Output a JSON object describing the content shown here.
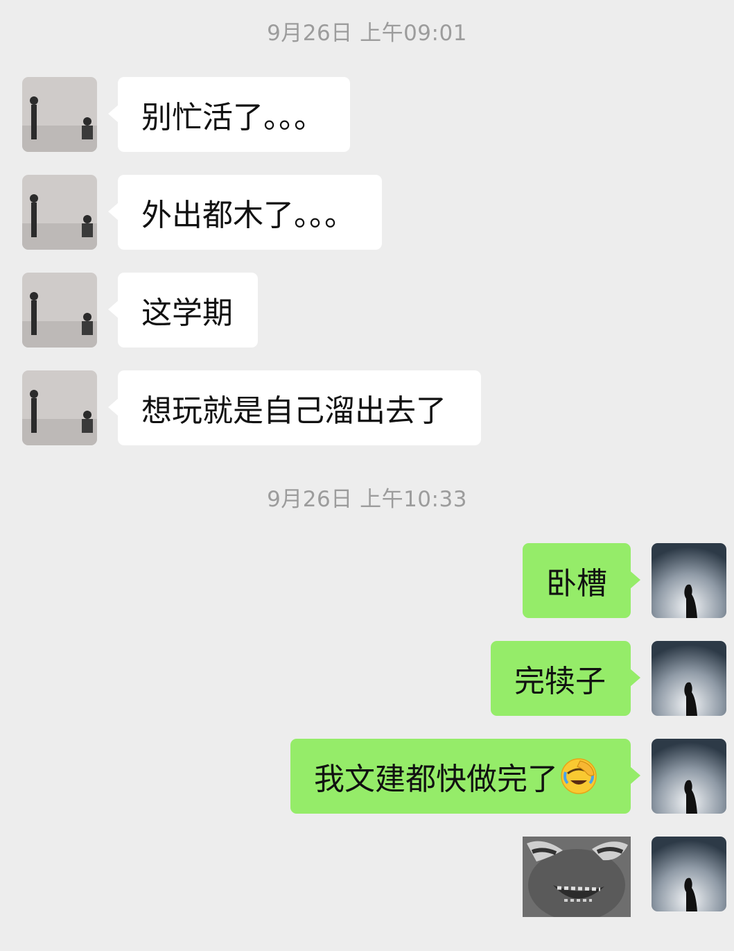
{
  "chat": {
    "timestamps": [
      "9月26日 上午09:01",
      "9月26日 上午10:33"
    ],
    "incoming": [
      "别忙活了。。。",
      "外出都木了。。。",
      "这学期",
      "想玩就是自己溜出去了"
    ],
    "outgoing": [
      "卧槽",
      "完犊子",
      "我文建都快做完了"
    ],
    "outgoing_emoji": "facepalm-laugh-emoji",
    "outgoing_sticker": "meme-face-sticker",
    "colors": {
      "background": "#ededed",
      "incoming_bubble": "#ffffff",
      "outgoing_bubble": "#95ec69",
      "timestamp_text": "#9c9c9c"
    }
  }
}
